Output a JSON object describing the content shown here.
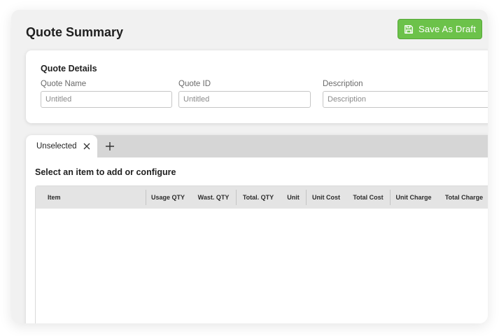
{
  "page": {
    "title": "Quote Summary",
    "save_button_label": "Save As Draft",
    "save_button_icon": "floppy-disk-icon",
    "accent_color": "#6cc24a"
  },
  "quote_details": {
    "title": "Quote Details",
    "fields": [
      {
        "label": "Quote Name",
        "value": "",
        "placeholder": "Untitled"
      },
      {
        "label": "Quote ID",
        "value": "",
        "placeholder": "Untitled"
      },
      {
        "label": "Description",
        "value": "",
        "placeholder": "Description"
      }
    ]
  },
  "tabs": {
    "items": [
      {
        "label": "Unselected",
        "close_icon": "close-icon"
      }
    ],
    "add_icon": "plus-icon"
  },
  "items": {
    "prompt": "Select an item to add or configure",
    "columns": [
      "Item",
      "Usage QTY",
      "Wast. QTY",
      "Total. QTY",
      "Unit",
      "Unit Cost",
      "Total Cost",
      "Unit Charge",
      "Total Charge"
    ],
    "rows": []
  }
}
